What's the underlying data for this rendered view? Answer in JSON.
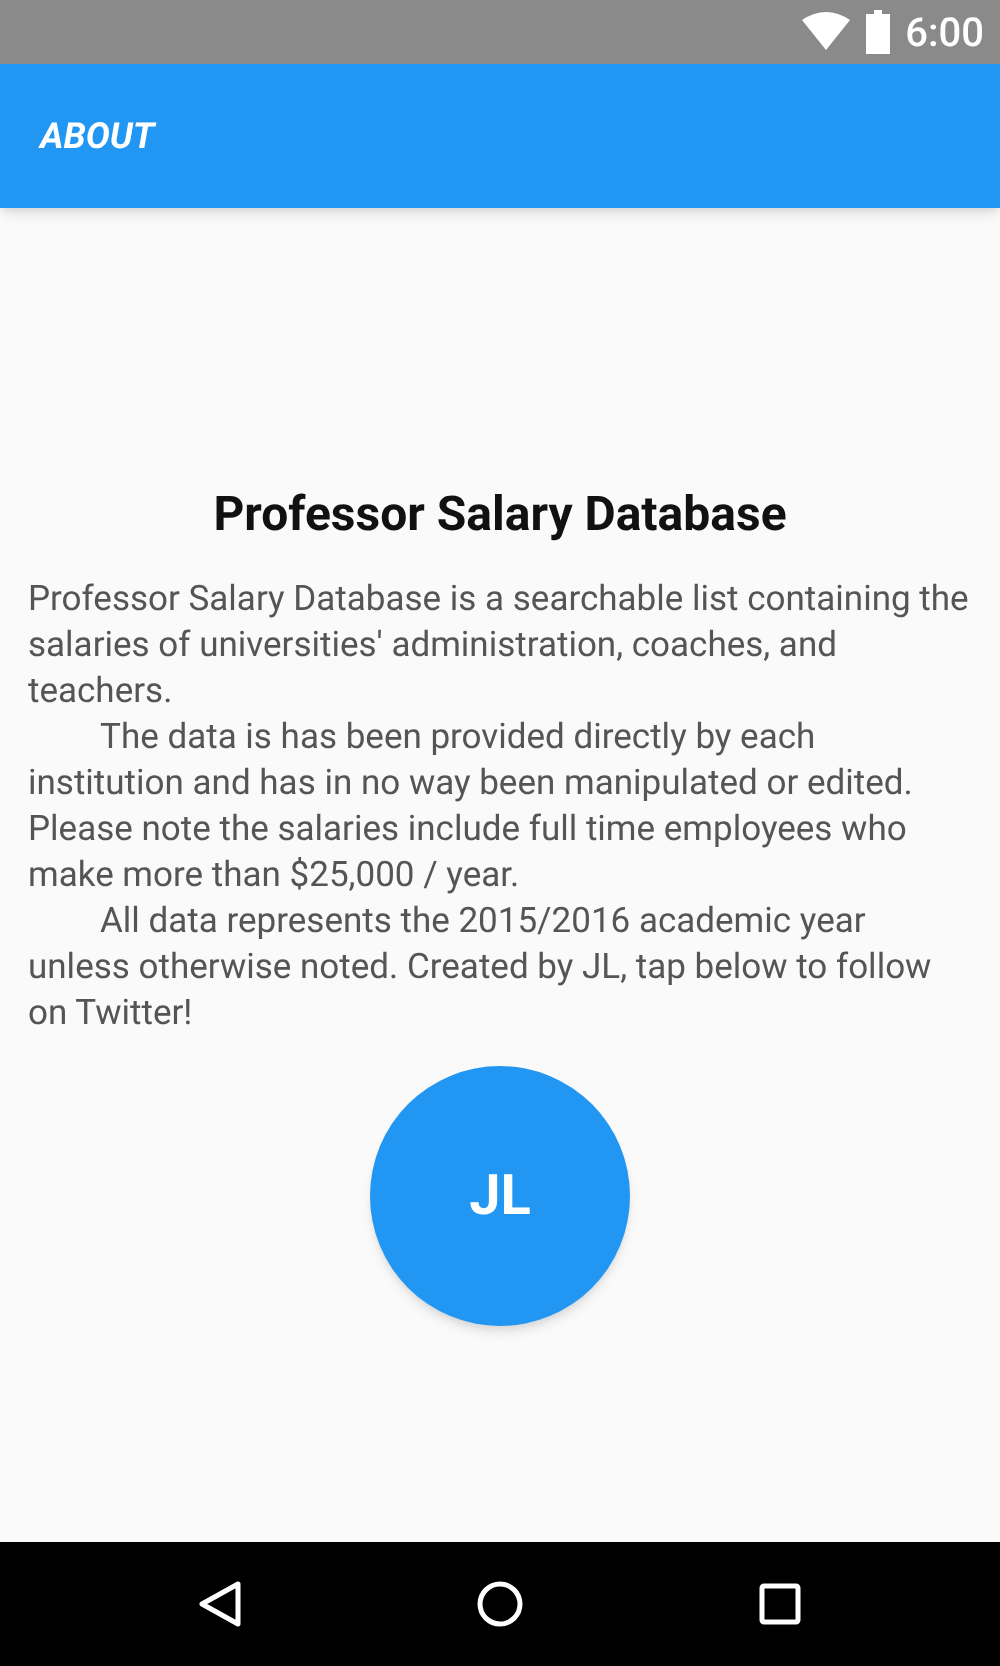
{
  "status_bar": {
    "time": "6:00"
  },
  "app_bar": {
    "title": "ABOUT"
  },
  "heading": "Professor Salary Database",
  "paragraphs": [
    {
      "text": "Professor Salary Database is a searchable list containing the salaries of universities' administration, coaches, and teachers.",
      "indented": false
    },
    {
      "text": "The data is has been provided directly by each institution and has in no way been manipulated or edited. Please note the salaries include full time employees who make more than $25,000 / year.",
      "indented": true
    },
    {
      "text": "All data represents the 2015/2016 academic year unless otherwise noted. Created by JL, tap below to follow on Twitter!",
      "indented": true
    }
  ],
  "avatar_button": {
    "initials": "JL"
  }
}
